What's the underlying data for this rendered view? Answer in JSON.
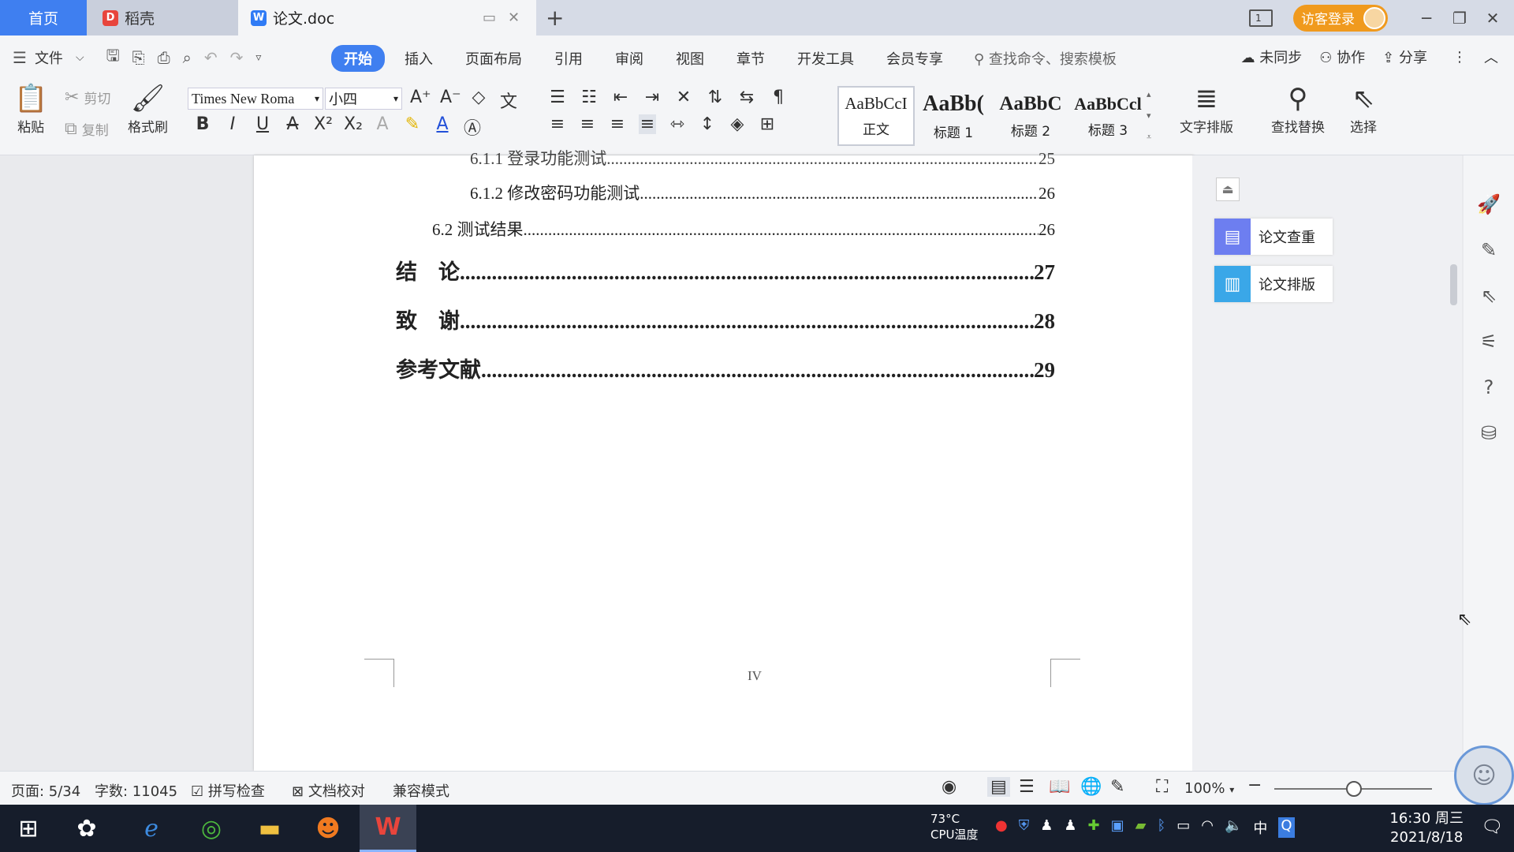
{
  "tabs": {
    "home": "首页",
    "daoke": "稻壳",
    "doc": "论文.doc",
    "new_tab": "+"
  },
  "window": {
    "login": "访客登录",
    "page_indicator": "1"
  },
  "menu": {
    "file": "文件",
    "tabs": [
      "开始",
      "插入",
      "页面布局",
      "引用",
      "审阅",
      "视图",
      "章节",
      "开发工具",
      "会员专享"
    ],
    "search_placeholder": "查找命令、搜索模板",
    "unsync": "未同步",
    "collab": "协作",
    "share": "分享"
  },
  "ribbon": {
    "paste": "粘贴",
    "cut": "剪切",
    "copy": "复制",
    "format_painter": "格式刷",
    "font_name": "Times New Roma",
    "font_size": "小四",
    "styles": [
      {
        "preview": "AaBbCcI",
        "name": "正文"
      },
      {
        "preview": "AaBb(",
        "name": "标题 1"
      },
      {
        "preview": "AaBbC",
        "name": "标题 2"
      },
      {
        "preview": "AaBbCcl",
        "name": "标题 3"
      }
    ],
    "text_layout": "文字排版",
    "find_replace": "查找替换",
    "select": "选择"
  },
  "document": {
    "toc": [
      {
        "level": 3,
        "title": "6.1.1  登录功能测试",
        "page": "25"
      },
      {
        "level": 3,
        "title": "6.1.2  修改密码功能测试",
        "page": "26"
      },
      {
        "level": 2,
        "title": "6.2  测试结果",
        "page": "26"
      },
      {
        "level": 1,
        "title": "结　论",
        "page": "27"
      },
      {
        "level": 1,
        "title": "致　谢",
        "page": "28"
      },
      {
        "level": 1,
        "title": "参考文献",
        "page": "29"
      }
    ],
    "page_footer": "IV"
  },
  "panel": {
    "check": "论文查重",
    "layout": "论文排版"
  },
  "status": {
    "page": "页面: 5/34",
    "words": "字数: 11045",
    "spell": "拼写检查",
    "proof": "文档校对",
    "compat": "兼容模式",
    "zoom": "100%"
  },
  "taskbar": {
    "temp": "73°C",
    "temp_label": "CPU温度",
    "ime": "中",
    "time": "16:30 周三",
    "date": "2021/8/18"
  },
  "colors": {
    "accent": "#3f7ff0",
    "login": "#f09a1e",
    "taskbar": "#161d2b"
  }
}
